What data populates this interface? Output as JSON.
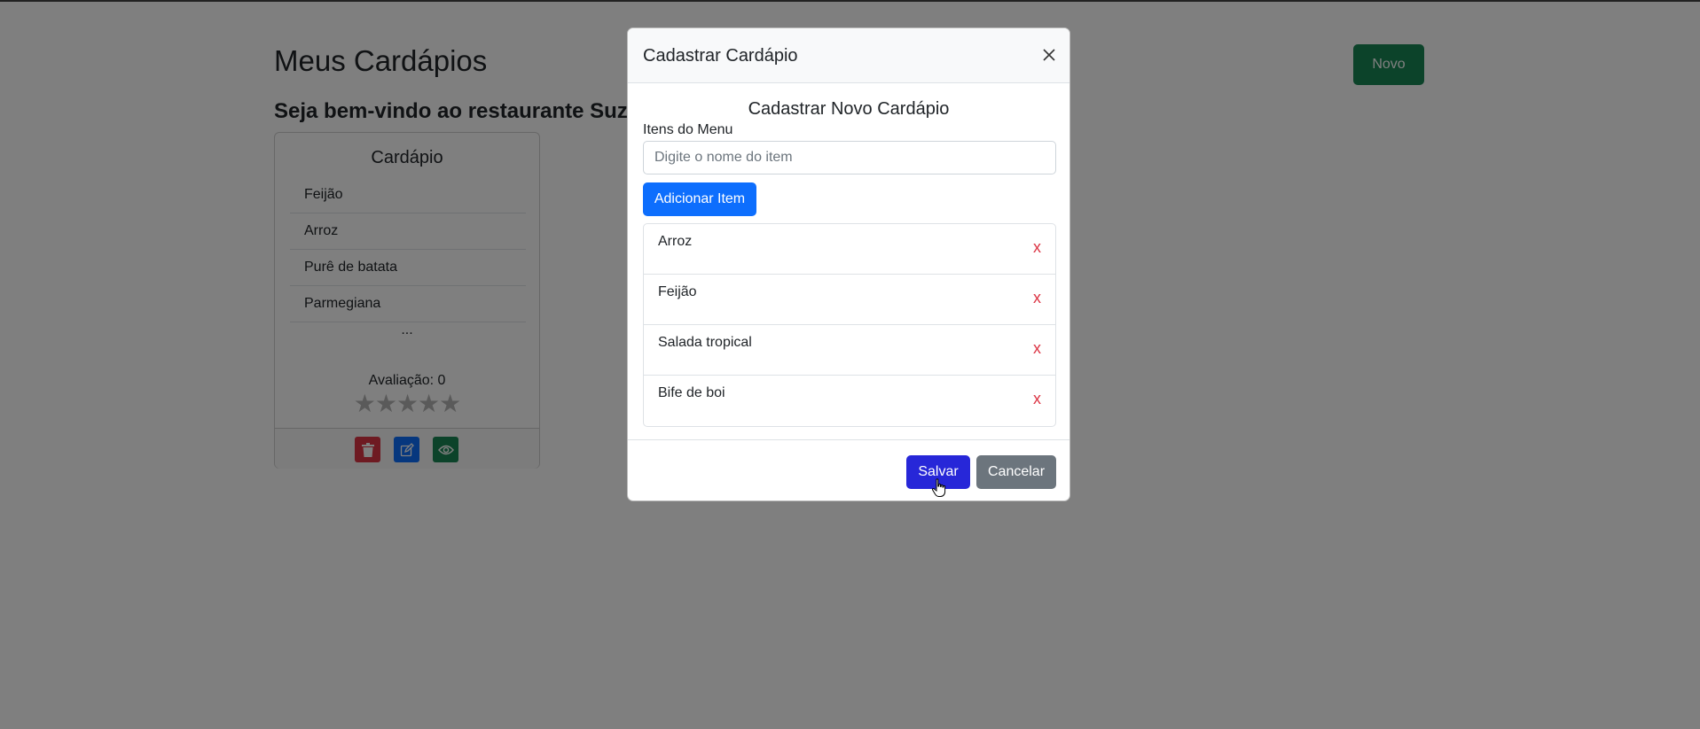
{
  "page": {
    "title": "Meus Cardápios",
    "welcome": "Seja bem-vindo ao restaurante Suzy",
    "new_button": "Novo"
  },
  "menu_card": {
    "title": "Cardápio",
    "items": [
      "Feijão",
      "Arroz",
      "Purê de batata",
      "Parmegiana"
    ],
    "more": "...",
    "rating_label": "Avaliação: 0",
    "rating_value": 0,
    "rating_max": 5,
    "stars": "★★★★★",
    "actions": [
      "trash-icon",
      "edit-icon",
      "eye-icon"
    ]
  },
  "modal": {
    "title": "Cadastrar Cardápio",
    "close_icon": "close-icon",
    "subtitle": "Cadastrar Novo Cardápio",
    "field_label": "Itens do Menu",
    "input_value": "",
    "input_placeholder": "Digite o nome do item",
    "add_button": "Adicionar Item",
    "items": [
      {
        "name": "Arroz",
        "remove": "x"
      },
      {
        "name": "Feijão",
        "remove": "x"
      },
      {
        "name": "Salada tropical",
        "remove": "x"
      },
      {
        "name": "Bife de boi",
        "remove": "x"
      }
    ],
    "save_button": "Salvar",
    "cancel_button": "Cancelar"
  },
  "colors": {
    "success": "#198754",
    "primary": "#0d6efd",
    "danger": "#dc3545",
    "save": "#2727d8",
    "secondary": "#6c757d",
    "backdrop": "rgba(0,0,0,0.5)"
  }
}
